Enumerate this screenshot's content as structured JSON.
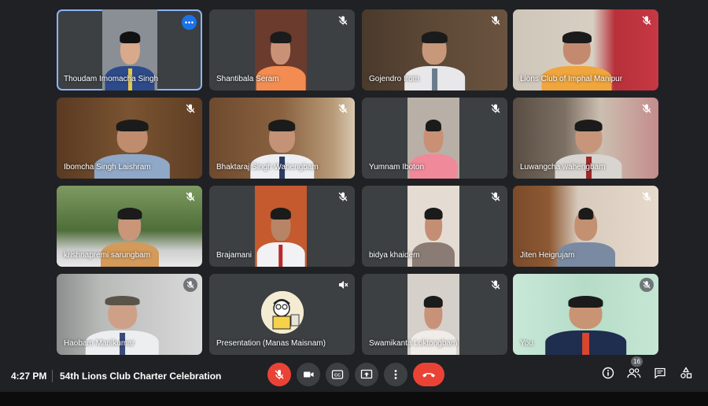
{
  "participants": [
    {
      "name": "Thoudam Imomacha Singh",
      "muted": false,
      "pinned": true
    },
    {
      "name": "Shantibala Seram",
      "muted": true
    },
    {
      "name": "Gojendro Irom",
      "muted": true
    },
    {
      "name": "Lions Club of Imphal Manipur",
      "muted": true
    },
    {
      "name": "Ibomcha Singh Laishram",
      "muted": true
    },
    {
      "name": "Bhaktaraj Singh Wahengbam",
      "muted": true
    },
    {
      "name": "Yumnam Iboton",
      "muted": true
    },
    {
      "name": "Luwangcha wahengbam",
      "muted": true
    },
    {
      "name": "krishnapremi sarungbam",
      "muted": true
    },
    {
      "name": "Brajamani",
      "muted": true
    },
    {
      "name": "bidya khaidem",
      "muted": true
    },
    {
      "name": "Jiten Heigrujam",
      "muted": true
    },
    {
      "name": "Haobam Manikumar",
      "muted": true
    },
    {
      "name": "Presentation (Manas Maisnam)",
      "muted": true
    },
    {
      "name": "Swamikanta Loktongbam",
      "muted": true
    },
    {
      "name": "You",
      "muted": true
    }
  ],
  "footer": {
    "time": "4:27 PM",
    "meeting_title": "54th Lions Club Charter Celebration",
    "people_count": "16"
  },
  "controls": {
    "mic": "mic-off-icon",
    "camera": "videocam-icon",
    "captions": "closed-captions-icon",
    "present": "present-screen-icon",
    "more": "more-vert-icon",
    "leave": "call-end-icon"
  },
  "right_controls": {
    "info": "info-icon",
    "people": "people-icon",
    "chat": "chat-icon",
    "activities": "activities-icon"
  },
  "colors": {
    "background": "#202124",
    "tile": "#3c4043",
    "accent": "#1a73e8",
    "danger": "#ea4335",
    "active_outline": "#8ab4f8"
  }
}
